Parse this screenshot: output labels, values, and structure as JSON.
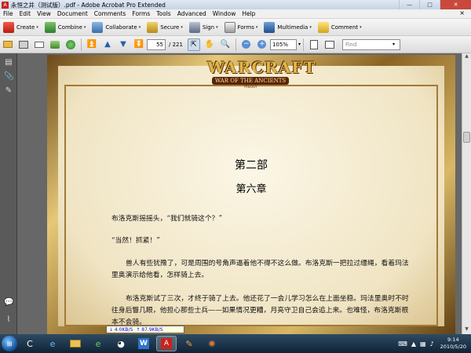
{
  "window": {
    "title": "永恒之井（测试版）.pdf - Adobe Acrobat Pro Extended",
    "minimize": "—",
    "maximize": "□",
    "close": "✕"
  },
  "menu": {
    "items": [
      "File",
      "Edit",
      "View",
      "Document",
      "Comments",
      "Forms",
      "Tools",
      "Advanced",
      "Window",
      "Help"
    ],
    "close_doc": "×"
  },
  "toolbar1": {
    "create": "Create",
    "combine": "Combine",
    "collaborate": "Collaborate",
    "secure": "Secure",
    "sign": "Sign",
    "forms": "Forms",
    "multimedia": "Multimedia",
    "comment": "Comment",
    "caret": "▾"
  },
  "toolbar2": {
    "current_page": "55",
    "total_pages": "/ 221",
    "zoom": "105%",
    "find_placeholder": "Find"
  },
  "document": {
    "logo_title": "WARCRAFT",
    "logo_subtitle": "WAR OF THE ANCIENTS",
    "logo_trilogy": "TRILOGY",
    "part": "第二部",
    "chapter": "第六章",
    "paragraphs": [
      "布洛克斯摇摇头，“我们就骑这个？”",
      "“当然！抓紧！”",
      "兽人有些犹豫了，可是周围的号角声逼着他不得不这么做。布洛克斯一把拉过缰绳，看着玛法里奥演示给他看，怎样骑上去。",
      "布洛克斯试了三次，才终于骑了上去。他还花了一会儿学习怎么在上面坐稳。玛法里奥时不时往身后瞥几眼，他担心那些士兵——如果情况更糟，月亮守卫自己会追上来。也难怪，布洛克斯根本不会骑。"
    ]
  },
  "taskbar": {
    "netspeed_down": "↓ 4.0KB/S",
    "netspeed_up": "↑ 87.9KB/S",
    "time": "9:14",
    "date": "2010/5/20"
  },
  "colors": {
    "acrobat_red": "#c8241b",
    "frame_gold": "#b78a3b",
    "taskbar": "#1a3146"
  }
}
